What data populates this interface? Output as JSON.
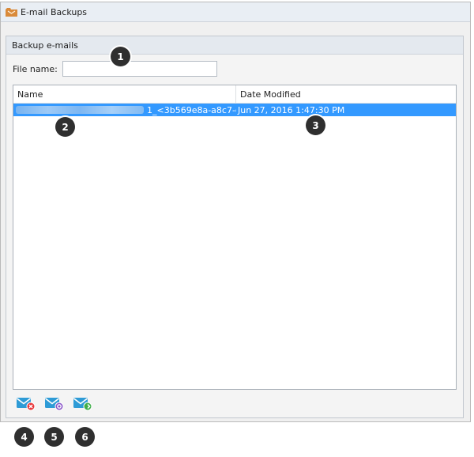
{
  "window": {
    "title": "E-mail Backups",
    "title_icon": "folder-icon"
  },
  "panel": {
    "header": "Backup e-mails"
  },
  "filename": {
    "label": "File name:",
    "value": "",
    "placeholder": ""
  },
  "filelist": {
    "columns": [
      "Name",
      "Date Modified"
    ],
    "rows": [
      {
        "name": "1_<3b569e8a-a8c7-c...",
        "date_modified": "Jun 27, 2016 1:47:30 PM",
        "selected": true
      }
    ]
  },
  "toolbar": {
    "buttons": [
      {
        "icon": "email-delete-icon"
      },
      {
        "icon": "email-restore-icon"
      },
      {
        "icon": "email-add-icon"
      }
    ]
  },
  "markers": [
    "1",
    "2",
    "3",
    "4",
    "5",
    "6"
  ],
  "colors": {
    "selection": "#3399ff",
    "marker": "#2f2f2f",
    "titlebar": "#e9eef4",
    "icon_blue": "#2e9bd6"
  }
}
